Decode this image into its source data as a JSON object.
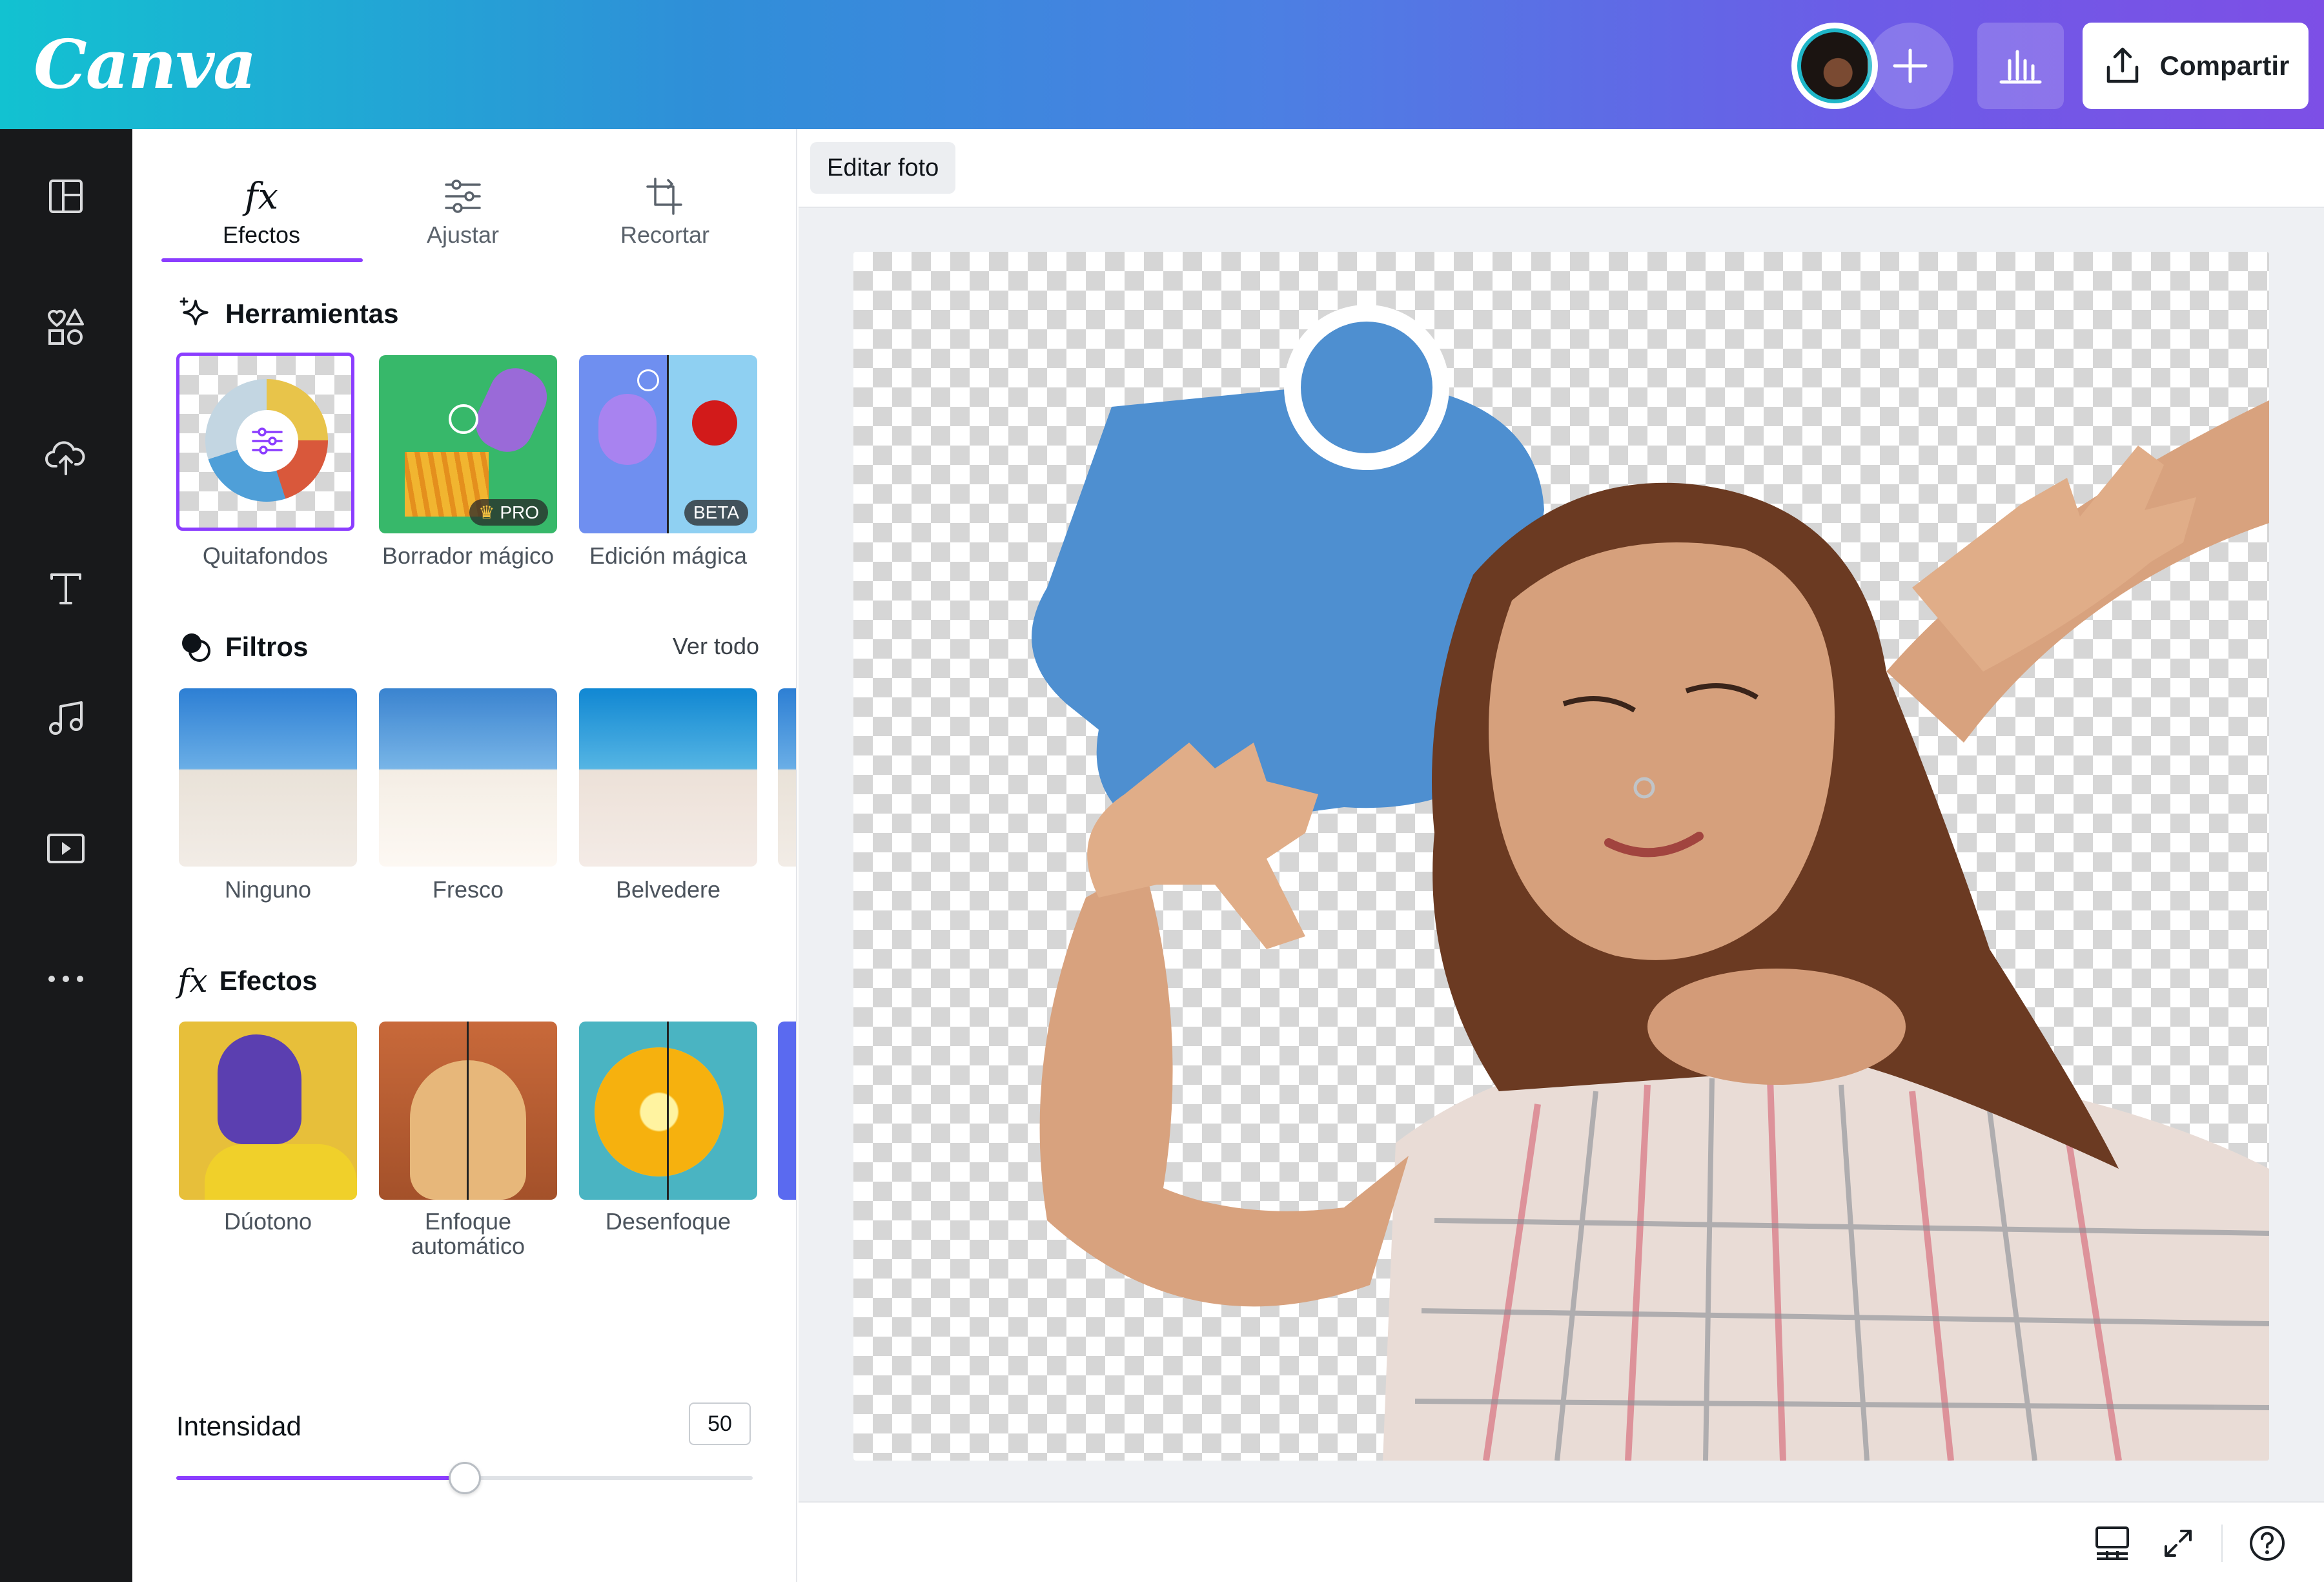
{
  "app": {
    "logo_text": "Canva"
  },
  "header": {
    "share_label": "Compartir"
  },
  "rail": {
    "icons": [
      "layout-icon",
      "elements-icon",
      "uploads-icon",
      "text-icon",
      "audio-icon",
      "video-icon",
      "more-icon"
    ]
  },
  "panel": {
    "tabs": [
      {
        "label": "Efectos",
        "icon": "fx-icon",
        "active": true
      },
      {
        "label": "Ajustar",
        "icon": "sliders-icon",
        "active": false
      },
      {
        "label": "Recortar",
        "icon": "crop-icon",
        "active": false
      }
    ],
    "tools": {
      "title": "Herramientas",
      "items": [
        {
          "label": "Quitafondos",
          "selected": true
        },
        {
          "label": "Borrador mágico",
          "badge": "PRO"
        },
        {
          "label": "Edición mágica",
          "badge": "BETA"
        }
      ]
    },
    "filters": {
      "title": "Filtros",
      "see_all": "Ver todo",
      "items": [
        {
          "label": "Ninguno"
        },
        {
          "label": "Fresco"
        },
        {
          "label": "Belvedere"
        }
      ]
    },
    "effects": {
      "title": "Efectos",
      "items": [
        {
          "label": "Dúotono"
        },
        {
          "label": "Enfoque automático"
        },
        {
          "label": "Desenfoque"
        }
      ]
    },
    "intensity": {
      "label": "Intensidad",
      "value": "50",
      "level": 0.5
    }
  },
  "editor": {
    "edit_photo_label": "Editar foto"
  },
  "colors": {
    "accent": "#8b3dff",
    "rail_bg": "#18191b",
    "shape_blue": "#4e8fd0"
  }
}
